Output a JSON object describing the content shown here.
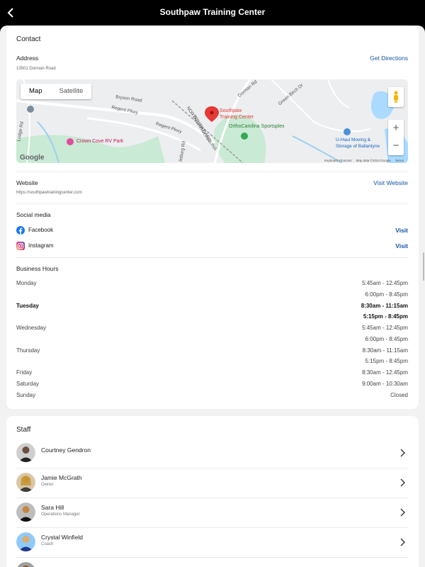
{
  "header": {
    "title": "Southpaw Training Center"
  },
  "contact": {
    "title": "Contact",
    "address_label": "Address",
    "address": "13501 Dorman Road",
    "directions_label": "Get Directions",
    "map": {
      "tabs": [
        "Map",
        "Satellite"
      ],
      "selected_tab": "Map",
      "labels": [
        "Southpaw",
        "Training Center",
        "OrthoCarolina Sportsplex",
        "Crown Cove RV Park",
        "U-Haul Moving &",
        "Storage of Ballantyne",
        "Regent Pkwy",
        "Regent Pkwy",
        "Bryson Road",
        "Dorman Rd",
        "Green Birch Dr",
        "NORTH CAROLINA",
        "SOUTH CAROLINA",
        "Lodge Rd",
        "lisburg Rd"
      ],
      "footer": [
        "Keyboard shortcuts",
        "Map data ©2024 Google",
        "Terms"
      ],
      "logo": "Google",
      "zoom_in": "+",
      "zoom_out": "−"
    },
    "website_label": "Website",
    "website_url": "https://southpawtrainingcenter.com",
    "website_link": "Visit Website",
    "social_label": "Social media",
    "socials": [
      {
        "name": "Facebook",
        "link": "Visit",
        "icon": "facebook-icon"
      },
      {
        "name": "Instagram",
        "link": "Visit",
        "icon": "instagram-icon"
      }
    ],
    "hours_label": "Business Hours",
    "hours": [
      {
        "day": "Monday",
        "times": [
          "5:45am - 12:45pm",
          "6:00pm - 8:45pm"
        ],
        "bold": false
      },
      {
        "day": "Tuesday",
        "times": [
          "8:30am - 11:15am",
          "5:15pm - 8:45pm"
        ],
        "bold": true
      },
      {
        "day": "Wednesday",
        "times": [
          "5:45am - 12:45pm",
          "6:00pm - 8:45pm"
        ],
        "bold": false
      },
      {
        "day": "Thursday",
        "times": [
          "8:30am - 11:15am",
          "5:15pm - 8:45pm"
        ],
        "bold": false
      },
      {
        "day": "Friday",
        "times": [
          "8:30am - 12:45pm"
        ],
        "bold": false
      },
      {
        "day": "Saturday",
        "times": [
          "9:00am - 10:30am"
        ],
        "bold": false
      },
      {
        "day": "Sunday",
        "times": [
          "Closed"
        ],
        "bold": false
      }
    ]
  },
  "staff": {
    "title": "Staff",
    "members": [
      {
        "name": "Courtney Gendron",
        "role": ""
      },
      {
        "name": "Jamie McGrath",
        "role": "Owner"
      },
      {
        "name": "Sara Hill",
        "role": "Operations Manager"
      },
      {
        "name": "Crystal Winfield",
        "role": "Coach"
      }
    ]
  },
  "colors": {
    "link": "#1255a3",
    "map_pin": "#e53935",
    "park_green": "#c9ead4"
  }
}
